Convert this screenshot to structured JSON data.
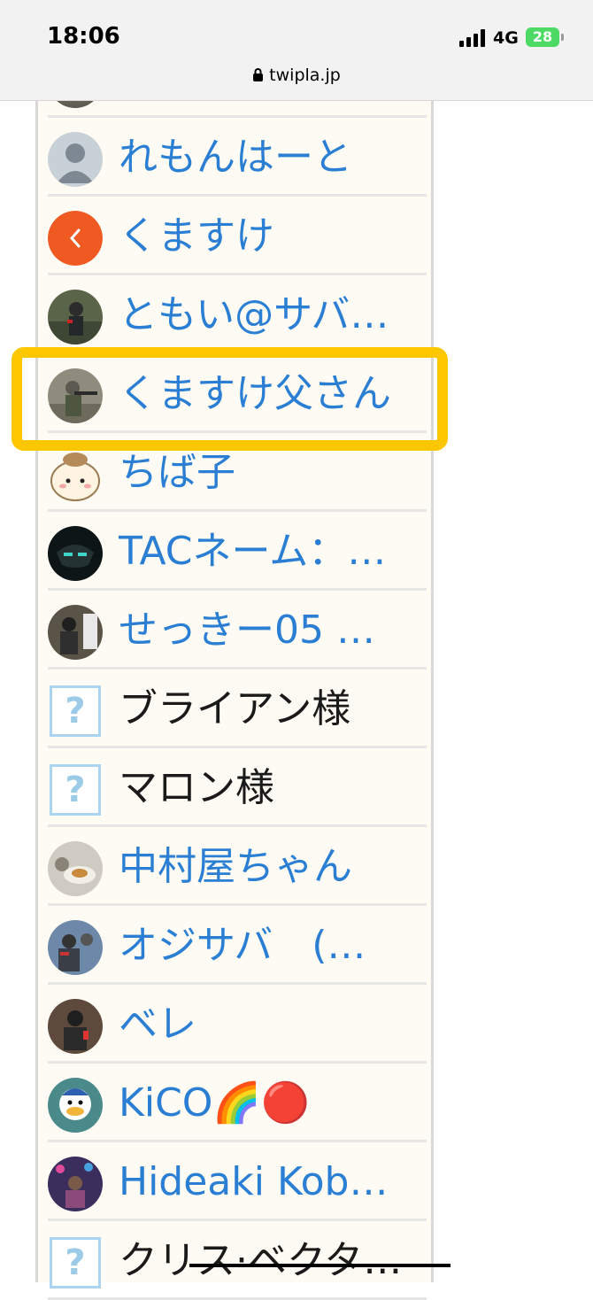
{
  "status_bar": {
    "time": "18:06",
    "network": "4G",
    "battery": "28"
  },
  "browser": {
    "url": "twipla.jp"
  },
  "colors": {
    "link_blue": "#2a7ed3",
    "highlight": "#fdc700"
  },
  "list": [
    {
      "name": "れもんはーと",
      "avatar": "default-user-icon"
    },
    {
      "name": "くますけ",
      "avatar": "orange-back-arrow-icon"
    },
    {
      "name": "ともい@サバ…",
      "avatar": "photo"
    },
    {
      "name": "くますけ父さん",
      "avatar": "photo"
    },
    {
      "name": "ちば子",
      "avatar": "cartoon"
    },
    {
      "name": "TACネーム：…",
      "avatar": "photo"
    },
    {
      "name": "せっきー05 …",
      "avatar": "photo"
    },
    {
      "name": "ブライアン様",
      "avatar": "unknown-question-icon"
    },
    {
      "name": "マロン様",
      "avatar": "unknown-question-icon"
    },
    {
      "name": "中村屋ちゃん",
      "avatar": "photo"
    },
    {
      "name": "オジサバ　(…",
      "avatar": "photo"
    },
    {
      "name": "ベレ",
      "avatar": "photo"
    },
    {
      "name": "KiCO🌈🔴",
      "avatar": "photo"
    },
    {
      "name": "Hideaki Kob…",
      "avatar": "photo"
    },
    {
      "name": "クリス·ベクタ…",
      "avatar": "unknown-question-icon"
    }
  ]
}
